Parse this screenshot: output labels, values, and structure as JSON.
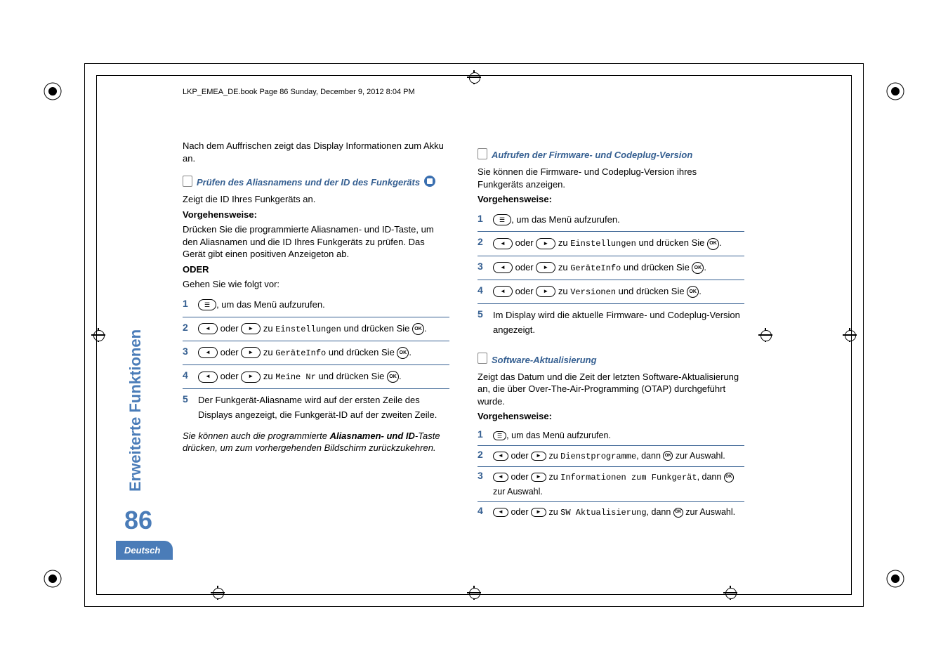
{
  "header": "LKP_EMEA_DE.book  Page 86  Sunday, December 9, 2012  8:04 PM",
  "sideLabel": "Erweiterte Funktionen",
  "pageNumber": "86",
  "langTab": "Deutsch",
  "left": {
    "introTop": "Nach dem Auffrischen zeigt das Display Informationen zum Akku an.",
    "sec1Title": "Prüfen des Aliasnamens und der ID des Funkgeräts",
    "sec1Sub": "Zeigt die ID Ihres Funkgeräts an.",
    "procLabel": "Vorgehensweise:",
    "procText1": "Drücken Sie die programmierte Aliasnamen- und ID-Taste, um den Aliasnamen und die ID Ihres Funkgeräts zu prüfen. Das Gerät gibt einen positiven Anzeigeton ab.",
    "oder": "ODER",
    "procText2": "Gehen Sie wie folgt vor:",
    "step1": ", um das Menü aufzurufen.",
    "step2a": " oder ",
    "step2b": " zu ",
    "step2c": "Einstellungen",
    "step2d": " und drücken Sie ",
    "step3c": "GeräteInfo",
    "step4c": "Meine Nr",
    "step5": "Der Funkgerät-Aliasname wird auf der ersten Zeile des Displays angezeigt, die Funkgerät-ID auf der zweiten Zeile.",
    "note1a": "Sie können auch die programmierte ",
    "note1b": "Aliasnamen- und ID",
    "note1c": "-Taste drücken, um zum vorhergehenden Bildschirm zurückzukehren."
  },
  "right": {
    "sec1Title": "Aufrufen der Firmware- und Codeplug-Version",
    "sec1Sub": "Sie können die Firmware- und Codeplug-Version ihres Funkgeräts anzeigen.",
    "procLabel": "Vorgehensweise:",
    "step1": ", um das Menü aufzurufen.",
    "stepOr": " oder ",
    "stepZu": " zu ",
    "stepDr": " und drücken Sie ",
    "w2": "Einstellungen",
    "w3": "GeräteInfo",
    "w4": "Versionen",
    "step5": "Im Display wird die aktuelle Firmware- und Codeplug-Version angezeigt.",
    "sec2Title": "Software-Aktualisierung",
    "sec2Sub": "Zeigt das Datum und die Zeit der letzten Software-Aktualisierung an, die über Over-The-Air-Programming (OTAP) durchgeführt wurde.",
    "s1": ", um das Menü aufzurufen.",
    "s2a": "Dienstprogramme",
    "s2b": ", dann ",
    "s2c": " zur Auswahl.",
    "s3a": "Informationen zum Funkgerät",
    "s3b": ", dann ",
    "s3c": " zur Auswahl.",
    "s4a": "SW Aktualisierung",
    "btnMenu": "☰",
    "btnOk": "OK"
  }
}
